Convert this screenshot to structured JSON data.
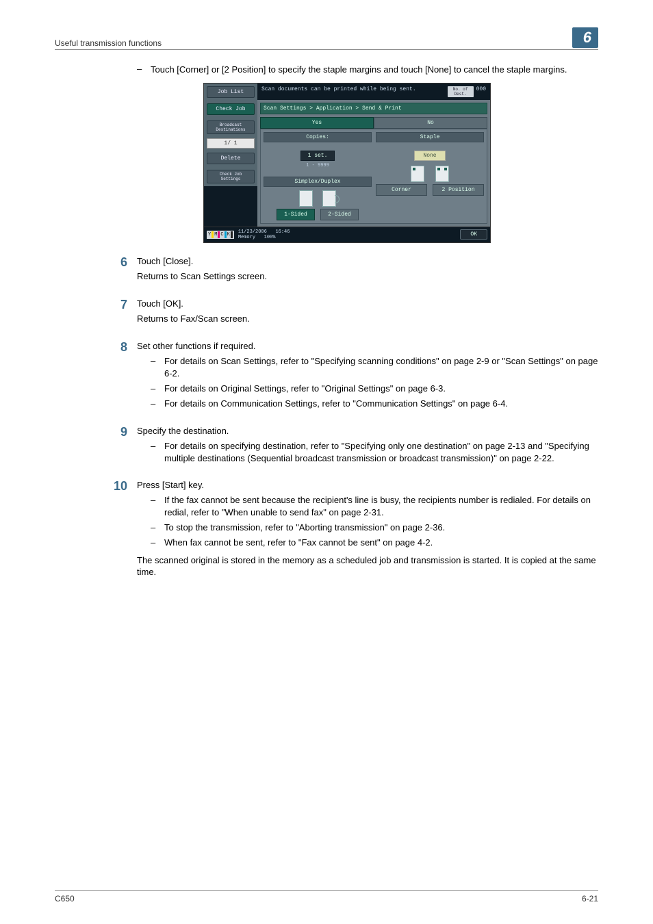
{
  "header": {
    "section_title": "Useful transmission functions",
    "chapter_badge": "6"
  },
  "intro_bullet": "Touch [Corner] or [2 Position] to specify the staple margins and touch [None] to cancel the staple margins.",
  "device": {
    "left": {
      "job_list": "Job List",
      "check_job": "Check Job",
      "broadcast": "Broadcast\nDestinations",
      "page": "1/  1",
      "delete": "Delete",
      "check_settings": "Check Job\nSettings"
    },
    "top": {
      "message": "Scan documents can be printed while being sent.",
      "dest_label": "No. of\nDest.",
      "dest_count": "000"
    },
    "breadcrumb": "Scan Settings > Application > Send & Print",
    "tabs": {
      "yes": "Yes",
      "no": "No"
    },
    "copies": {
      "title": "Copies:",
      "set": "1 set.",
      "range": "1   -   9999"
    },
    "simplex": {
      "title": "Simplex/Duplex",
      "one": "1-Sided",
      "two": "2-Sided"
    },
    "staple": {
      "title": "Staple",
      "none": "None",
      "corner": "Corner",
      "two_pos": "2 Position"
    },
    "footer": {
      "ymck": {
        "y": "Y",
        "m": "M",
        "c": "C",
        "k": "K"
      },
      "date": "11/23/2006",
      "time": "16:46",
      "mem_label": "Memory",
      "mem_val": "100%",
      "ok": "OK"
    }
  },
  "steps": {
    "s6": {
      "num": "6",
      "line1": "Touch [Close].",
      "line2": "Returns to Scan Settings screen."
    },
    "s7": {
      "num": "7",
      "line1": "Touch [OK].",
      "line2": "Returns to Fax/Scan screen."
    },
    "s8": {
      "num": "8",
      "line1": "Set other functions if required.",
      "b1": "For details on Scan Settings, refer to \"Specifying scanning conditions\" on page 2-9 or \"Scan Settings\" on page 6-2.",
      "b2": "For details on Original Settings, refer to \"Original Settings\" on page 6-3.",
      "b3": "For details on Communication Settings, refer to \"Communication Settings\" on page 6-4."
    },
    "s9": {
      "num": "9",
      "line1": "Specify the destination.",
      "b1": "For details on specifying destination, refer to \"Specifying only one destination\" on page 2-13 and \"Specifying multiple destinations (Sequential broadcast transmission or broadcast transmission)\" on page 2-22."
    },
    "s10": {
      "num": "10",
      "line1": "Press [Start] key.",
      "b1": "If the fax cannot be sent because the recipient's line is busy, the recipients number is redialed. For details on redial, refer to \"When unable to send fax\" on page 2-31.",
      "b2": "To stop the transmission, refer to \"Aborting transmission\" on page 2-36.",
      "b3": "When fax cannot be sent, refer to \"Fax cannot be sent\" on page 4-2.",
      "end": "The scanned original is stored in the memory as a scheduled job and transmission is started. It is copied at the same time."
    }
  },
  "footer": {
    "left": "C650",
    "right": "6-21"
  }
}
